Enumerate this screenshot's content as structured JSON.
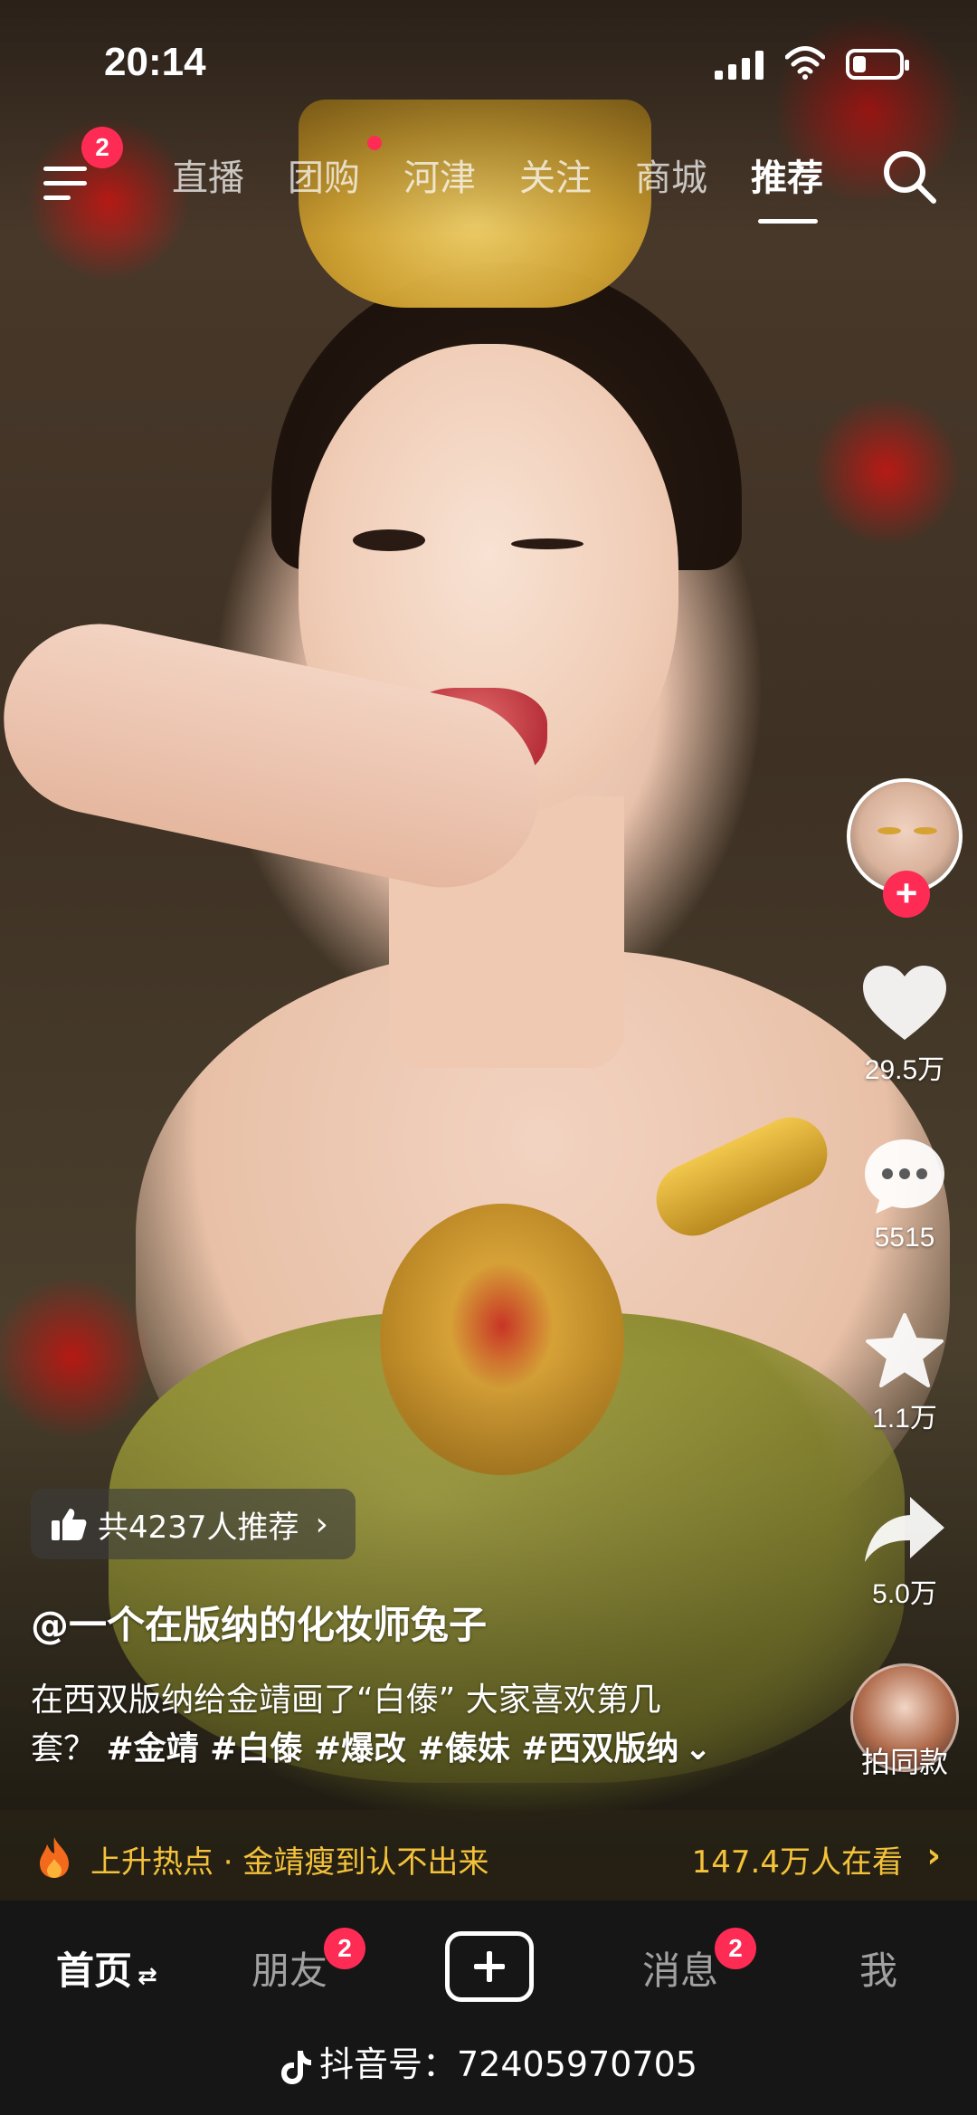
{
  "status_bar": {
    "time": "20:14",
    "battery_level": 0.3
  },
  "top_nav": {
    "menu_badge": "2",
    "tabs": [
      {
        "label": "直播"
      },
      {
        "label": "团购"
      },
      {
        "label": "河津"
      },
      {
        "label": "关注"
      },
      {
        "label": "商城"
      },
      {
        "label": "推荐"
      }
    ],
    "active_tab": "推荐"
  },
  "actions": {
    "likes": "29.5万",
    "comments": "5515",
    "favorites": "1.1万",
    "shares": "5.0万",
    "same_style": "拍同款"
  },
  "video": {
    "recommend_count": "共4237人推荐",
    "author": "@一个在版纳的化妆师兔子",
    "caption_line1": "在西双版纳给金靖画了“白傣” 大家喜欢第几",
    "caption_line2_prefix": "套？",
    "hashtags": "#金靖 #白傣 #爆改 #傣妹 #西双版纳"
  },
  "trending": {
    "text": "上升热点 · 金靖瘦到认不出来",
    "viewers": "147.4万人在看"
  },
  "tabbar": {
    "home": "首页",
    "friends": "朋友",
    "friends_badge": "2",
    "messages": "消息",
    "messages_badge": "2",
    "me": "我"
  },
  "watermark": "抖音号：72405970705",
  "colors": {
    "accent": "#fe2c55",
    "trending": "#f4c23a",
    "tabbar_bg": "#161616"
  },
  "icons": [
    "menu-icon",
    "search-icon",
    "heart-icon",
    "comment-icon",
    "star-icon",
    "share-icon",
    "thumb-up-icon",
    "flame-icon",
    "tiktok-logo-icon",
    "plus-icon"
  ]
}
